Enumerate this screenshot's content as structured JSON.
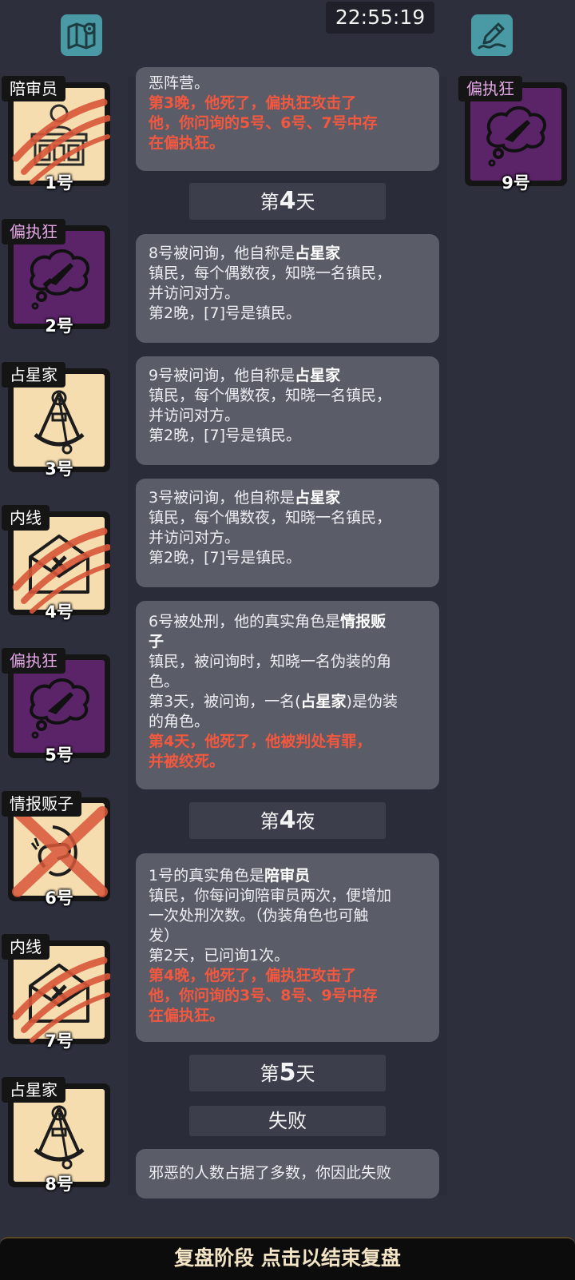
{
  "header": {
    "time": "22:55:19",
    "map_icon": "map-icon",
    "notes_icon": "pencil-notes-icon"
  },
  "players": [
    {
      "role": "陪审员",
      "number": "1号",
      "icon": "jury-box-icon",
      "evil": false,
      "dead": true
    },
    {
      "role": "偏执狂",
      "number": "2号",
      "icon": "knife-thought-icon",
      "evil": true,
      "dead": false
    },
    {
      "role": "占星家",
      "number": "3号",
      "icon": "sextant-icon",
      "evil": false,
      "dead": false
    },
    {
      "role": "内线",
      "number": "4号",
      "icon": "envelope-icon",
      "evil": false,
      "dead": true
    },
    {
      "role": "偏执狂",
      "number": "5号",
      "icon": "knife-thought-icon",
      "evil": true,
      "dead": false
    },
    {
      "role": "情报贩子",
      "number": "6号",
      "icon": "hand-icon",
      "evil": false,
      "dead": true
    },
    {
      "role": "内线",
      "number": "7号",
      "icon": "envelope-icon",
      "evil": false,
      "dead": true
    },
    {
      "role": "占星家",
      "number": "8号",
      "icon": "sextant-icon",
      "evil": false,
      "dead": false
    },
    {
      "role": "偏执狂",
      "number": "9号",
      "icon": "knife-thought-icon",
      "evil": true,
      "dead": false
    }
  ],
  "log": {
    "card0": {
      "l1": "恶阵营。",
      "r1": "第3晚，他死了，偏执狂攻击了",
      "r2": "他，你问询的5号、6号、7号中存",
      "r3": "在偏执狂。"
    },
    "day4_pre": "第",
    "day4_num": "4",
    "day4_suf": "天",
    "card1": {
      "pre": "8号被问询，他自称是",
      "role": "占星家",
      "l2": "镇民，每个偶数夜，知晓一名镇民，",
      "l3": "并访问对方。",
      "l4": "第2晚，[7]号是镇民。"
    },
    "card2": {
      "pre": "9号被问询，他自称是",
      "role": "占星家",
      "l2": "镇民，每个偶数夜，知晓一名镇民，",
      "l3": "并访问对方。",
      "l4": "第2晚，[7]号是镇民。"
    },
    "card3": {
      "pre": "3号被问询，他自称是",
      "role": "占星家",
      "l2": "镇民，每个偶数夜，知晓一名镇民，",
      "l3": "并访问对方。",
      "l4": "第2晚，[7]号是镇民。"
    },
    "card4": {
      "pre": "6号被处刑，他的真实角色是",
      "role1": "情报贩",
      "role2": "子",
      "l2": "镇民，被问询时，知晓一名伪装的角",
      "l3": "色。",
      "l4a": "第3天，被问询，一名(",
      "l4role": "占星家",
      "l4b": ")是伪装",
      "l5": "的角色。",
      "r1": "第4天，他死了，他被判处有罪，",
      "r2": "并被绞死。"
    },
    "night4_pre": "第",
    "night4_num": "4",
    "night4_suf": "夜",
    "card5": {
      "pre": "1号的真实角色是",
      "role": "陪审员",
      "l2": "镇民，你每问询陪审员两次，便增加",
      "l3": "一次处刑次数。（伪装角色也可触",
      "l4": "发）",
      "l5": "第2天，已问询1次。",
      "r1": "第4晚，他死了，偏执狂攻击了",
      "r2": "他，你问询的3号、8号、9号中存",
      "r3": "在偏执狂。"
    },
    "day5_pre": "第",
    "day5_num": "5",
    "day5_suf": "天",
    "result": "失败",
    "card6": {
      "l1": "邪恶的人数占据了多数，你因此失败"
    }
  },
  "footer": {
    "label": "复盘阶段 点击以结束复盘"
  },
  "colors": {
    "background": "#2d2f3d",
    "card": "#5a5c68",
    "red_text": "#f3583f",
    "evil_tile": "#5b2468",
    "good_tile": "#f5ddb0",
    "teal_button": "#4a9aa6"
  }
}
